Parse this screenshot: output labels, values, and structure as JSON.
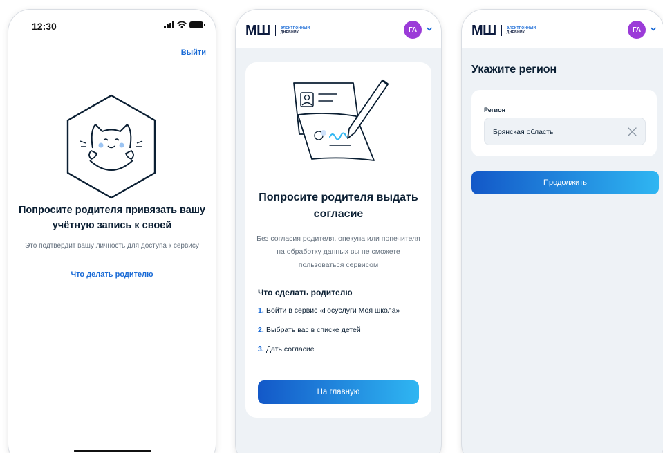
{
  "screen1": {
    "status_time": "12:30",
    "logout_label": "Выйти",
    "title": "Попросите родителя привязать вашу учётную запись к своей",
    "subtitle": "Это подтвердит вашу личность для доступа к сервису",
    "link_label": "Что делать родителю",
    "illustration_icon": "cat-icon"
  },
  "app": {
    "logo_mark": "МШ",
    "logo_line1": "ЭЛЕКТРОННЫЙ",
    "logo_line2": "ДНЕВНИК",
    "avatar_initials": "ГА",
    "avatar_color": "#9b3bd8",
    "accent_color": "#1a6bd6"
  },
  "screen2": {
    "title": "Попросите родителя выдать согласие",
    "subtitle": "Без согласия родителя, опекуна или попечителя на обработку данных вы не сможете пользоваться сервисом",
    "steps_title": "Что сделать родителю",
    "steps": [
      {
        "num": "1.",
        "text": "Войти в сервис «Госуслуги Моя школа»"
      },
      {
        "num": "2.",
        "text": "Выбрать вас в списке детей"
      },
      {
        "num": "3.",
        "text": "Дать согласие"
      }
    ],
    "home_button": "На главную",
    "illustration_icon": "signed-document-icon"
  },
  "screen3": {
    "title": "Укажите регион",
    "field_label": "Регион",
    "field_value": "Брянская область",
    "continue_button": "Продолжить"
  }
}
